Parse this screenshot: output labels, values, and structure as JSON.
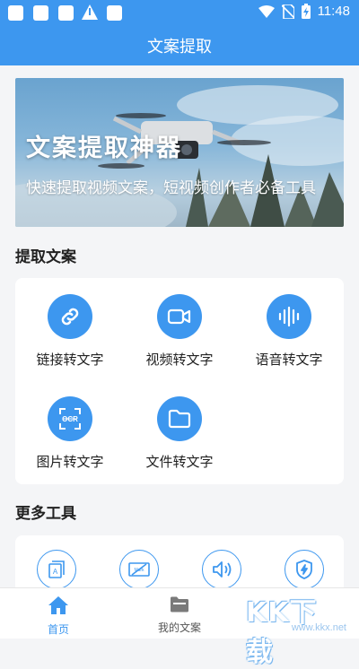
{
  "status_bar": {
    "time": "11:48"
  },
  "header": {
    "title": "文案提取"
  },
  "banner": {
    "title": "文案提取神器",
    "subtitle": "快速提取视频文案，短视频创作者必备工具"
  },
  "extract_section": {
    "title": "提取文案",
    "tools": [
      {
        "label": "链接转文字",
        "icon": "link-icon"
      },
      {
        "label": "视频转文字",
        "icon": "video-icon"
      },
      {
        "label": "语音转文字",
        "icon": "audio-wave-icon"
      },
      {
        "label": "图片转文字",
        "icon": "ocr-icon"
      },
      {
        "label": "文件转文字",
        "icon": "folder-icon"
      }
    ]
  },
  "more_section": {
    "title": "更多工具",
    "items": [
      {
        "icon": "text-edit-icon"
      },
      {
        "icon": "watermark-remove-icon"
      },
      {
        "icon": "speaker-icon"
      },
      {
        "icon": "shield-bolt-icon"
      }
    ]
  },
  "bottom_nav": {
    "items": [
      {
        "label": "首页",
        "icon": "home-icon",
        "active": true
      },
      {
        "label": "我的文案",
        "icon": "folder-icon",
        "active": false
      }
    ]
  },
  "watermark": {
    "logo_text": "KK下载",
    "url": "www.kkx.net"
  },
  "colors": {
    "primary": "#3d97ef",
    "background": "#f4f5f7",
    "text": "#222222",
    "muted": "#666666"
  }
}
